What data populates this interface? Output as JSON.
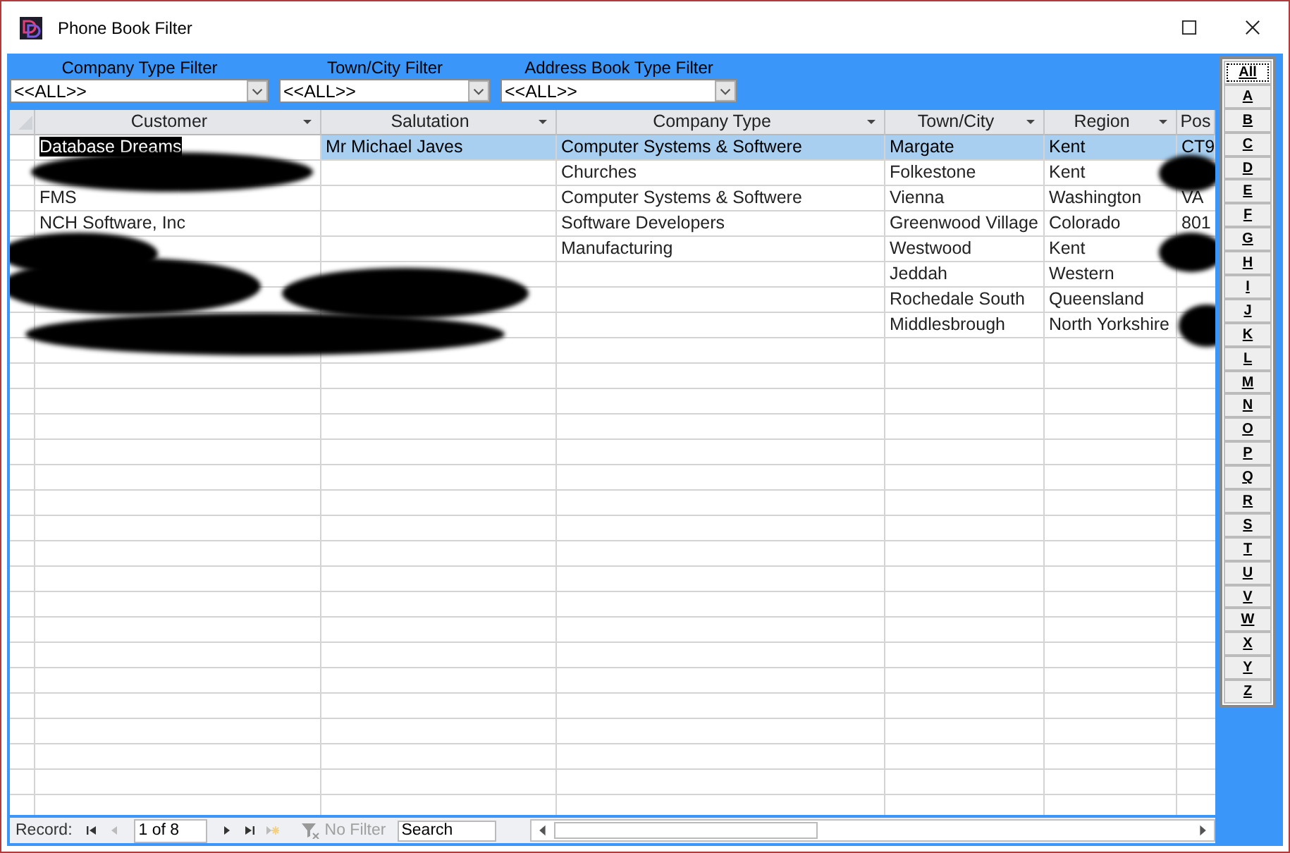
{
  "window": {
    "title": "Phone Book Filter"
  },
  "filters": [
    {
      "label": "Company Type Filter",
      "value": "<<ALL>>"
    },
    {
      "label": "Town/City Filter",
      "value": "<<ALL>>"
    },
    {
      "label": "Address Book Type Filter",
      "value": "<<ALL>>"
    }
  ],
  "table": {
    "columns": [
      "Customer",
      "Salutation",
      "Company Type",
      "Town/City",
      "Region",
      "Pos"
    ],
    "rows": [
      {
        "selected": true,
        "cells": [
          "Database Dreams",
          "Mr Michael Javes",
          "Computer Systems & Softwere",
          "Margate",
          "Kent",
          "CT9"
        ]
      },
      {
        "selected": false,
        "cells": [
          "",
          "",
          "Churches",
          "Folkestone",
          "Kent",
          ""
        ]
      },
      {
        "selected": false,
        "cells": [
          "FMS",
          "",
          "Computer Systems & Softwere",
          "Vienna",
          "Washington",
          "VA"
        ]
      },
      {
        "selected": false,
        "cells": [
          "NCH Software, Inc",
          "",
          "Software Developers",
          "Greenwood Village",
          "Colorado",
          "801"
        ]
      },
      {
        "selected": false,
        "cells": [
          "",
          "",
          "Manufacturing",
          "Westwood",
          "Kent",
          ""
        ]
      },
      {
        "selected": false,
        "cells": [
          "",
          "",
          "",
          "Jeddah",
          "Western",
          ""
        ]
      },
      {
        "selected": false,
        "cells": [
          "",
          "",
          "",
          "Rochedale South",
          "Queensland",
          ""
        ]
      },
      {
        "selected": false,
        "cells": [
          "",
          "",
          "",
          "Middlesbrough",
          "North Yorkshire",
          ""
        ]
      }
    ]
  },
  "letters": [
    {
      "label": "All",
      "selected": true
    },
    {
      "label": "A",
      "selected": false
    },
    {
      "label": "B",
      "selected": false
    },
    {
      "label": "C",
      "selected": false
    },
    {
      "label": "D",
      "selected": false
    },
    {
      "label": "E",
      "selected": false
    },
    {
      "label": "F",
      "selected": false
    },
    {
      "label": "G",
      "selected": false
    },
    {
      "label": "H",
      "selected": false
    },
    {
      "label": "I",
      "selected": false
    },
    {
      "label": "J",
      "selected": false
    },
    {
      "label": "K",
      "selected": false
    },
    {
      "label": "L",
      "selected": false
    },
    {
      "label": "M",
      "selected": false
    },
    {
      "label": "N",
      "selected": false
    },
    {
      "label": "O",
      "selected": false
    },
    {
      "label": "P",
      "selected": false
    },
    {
      "label": "Q",
      "selected": false
    },
    {
      "label": "R",
      "selected": false
    },
    {
      "label": "S",
      "selected": false
    },
    {
      "label": "T",
      "selected": false
    },
    {
      "label": "U",
      "selected": false
    },
    {
      "label": "V",
      "selected": false
    },
    {
      "label": "W",
      "selected": false
    },
    {
      "label": "X",
      "selected": false
    },
    {
      "label": "Y",
      "selected": false
    },
    {
      "label": "Z",
      "selected": false
    }
  ],
  "record_nav": {
    "label": "Record:",
    "position": "1 of 8",
    "buttons": [
      {
        "kind": "first",
        "disabled": false
      },
      {
        "kind": "prev",
        "disabled": true
      },
      {
        "kind": "next",
        "disabled": false
      },
      {
        "kind": "last",
        "disabled": false
      },
      {
        "kind": "new",
        "disabled": true
      }
    ],
    "filter": {
      "label": "No Filter",
      "disabled": true
    },
    "search_placeholder": "Search"
  }
}
